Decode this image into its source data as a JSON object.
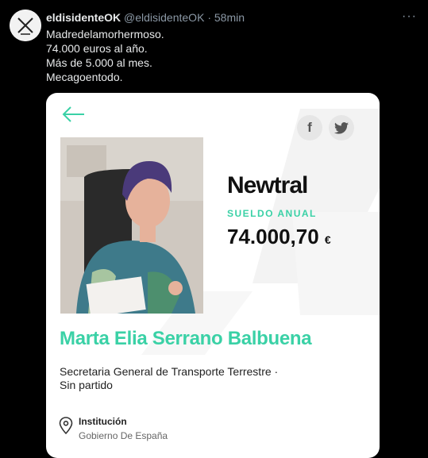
{
  "tweet": {
    "display_name": "eldisidenteOK",
    "handle": "@eldisidenteOK",
    "separator": "·",
    "time": "58min",
    "more_icon": "more-icon",
    "lines": [
      "Madredelamorhermoso.",
      "74.000 euros al año.",
      "Más de 5.000 al mes.",
      "Mecagoentodo."
    ]
  },
  "card": {
    "back_icon": "arrow-left-icon",
    "facebook_glyph": "f",
    "brand": "Newtral",
    "salary_label": "SUELDO ANUAL",
    "salary_value": "74.000,70",
    "salary_currency": "€",
    "person_name": "Marta Elia Serrano Balbuena",
    "role_line1": "Secretaria General de Transporte Terrestre ·",
    "role_line2": "Sin partido",
    "institution_label": "Institución",
    "institution_value": "Gobierno De España"
  },
  "colors": {
    "accent": "#3ad1a6",
    "background": "#000000",
    "card": "#ffffff",
    "muted": "#8b98a5"
  }
}
